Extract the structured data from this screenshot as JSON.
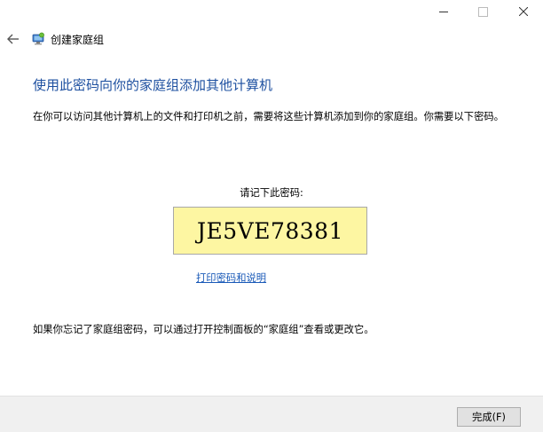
{
  "window": {
    "title": "创建家庭组",
    "caption_buttons": [
      "minimize",
      "maximize",
      "close"
    ]
  },
  "main": {
    "heading": "使用此密码向你的家庭组添加其他计算机",
    "description": "在你可以访问其他计算机上的文件和打印机之前，需要将这些计算机添加到你的家庭组。你需要以下密码。",
    "password_label": "请记下此密码:",
    "password": "JE5VE78381",
    "print_link": "打印密码和说明",
    "footnote": "如果你忘记了家庭组密码，可以通过打开控制面板的“家庭组”查看或更改它。"
  },
  "footer": {
    "finish_label": "完成(F)"
  },
  "colors": {
    "heading": "#1e50a0",
    "link": "#1a5ab8",
    "password_bg": "#fdf6a2",
    "footer_bg": "#f0f0f0"
  },
  "icons": {
    "back": "back-arrow-icon",
    "homegroup": "homegroup-icon",
    "minimize": "minimize-icon",
    "maximize": "maximize-icon",
    "close": "close-icon"
  }
}
